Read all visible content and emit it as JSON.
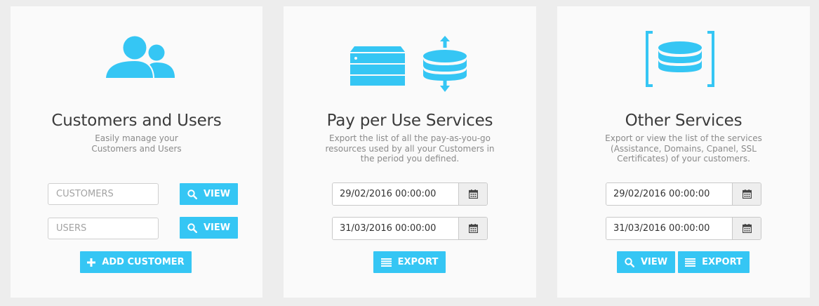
{
  "customers_card": {
    "title": "Customers and Users",
    "description": "Easily manage your Customers and Users",
    "customers_placeholder": "CUSTOMERS",
    "users_placeholder": "USERS",
    "view_label": "VIEW",
    "add_customer_label": "ADD CUSTOMER"
  },
  "payperuse_card": {
    "title": "Pay per Use Services",
    "description": "Export the list of all the pay-as-you-go resources used by all your Customers in the period you defined.",
    "date_from": "29/02/2016 00:00:00",
    "date_to": "31/03/2016 00:00:00",
    "export_label": "EXPORT"
  },
  "other_card": {
    "title": "Other Services",
    "description": "Export or view the list of the services (Assistance, Domains, Cpanel, SSL Certificates) of your customers.",
    "date_from": "29/02/2016 00:00:00",
    "date_to": "31/03/2016 00:00:00",
    "view_label": "VIEW",
    "export_label": "EXPORT"
  },
  "icons": {
    "users": "users-icon",
    "server": "server-icon",
    "database_sync": "database-sync-icon",
    "database_brackets": "database-brackets-icon",
    "search": "search-icon",
    "plus": "plus-icon",
    "list": "list-icon",
    "calendar": "calendar-icon"
  },
  "colors": {
    "accent": "#35c6f4",
    "background": "#ededed",
    "card": "#fafafa",
    "title": "#3c3c3c",
    "description": "#8a8a8a"
  }
}
